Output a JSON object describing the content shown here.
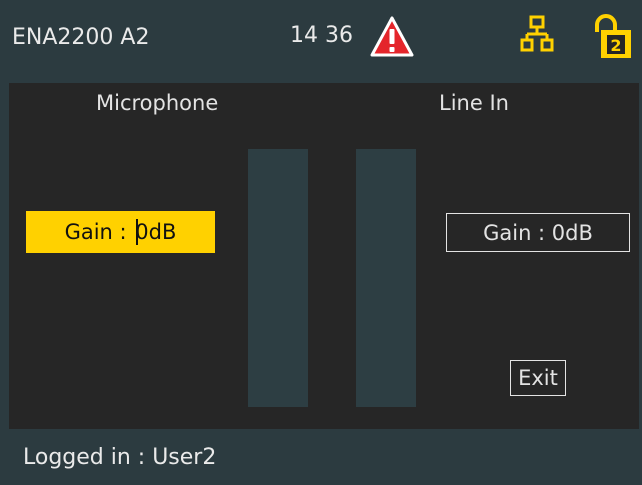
{
  "header": {
    "title": "ENA2200 A2",
    "clock": "14 36",
    "warning_icon": "warning-triangle-icon",
    "network_icon": "network-icon",
    "lock_icon": "unlocked-padlock-icon",
    "lock_level": "2"
  },
  "inputs": {
    "microphone": {
      "label": "Microphone",
      "gain_prefix": "Gain : ",
      "gain_value": "0dB"
    },
    "line_in": {
      "label": "Line In",
      "gain_text": "Gain : 0dB"
    }
  },
  "exit_label": "Exit",
  "footer": {
    "status": "Logged in : User2"
  },
  "colors": {
    "accent": "#ffd100",
    "warning": "#e4252b",
    "panel": "#2c3b40",
    "background": "#262626",
    "meter": "#2d3e43"
  }
}
